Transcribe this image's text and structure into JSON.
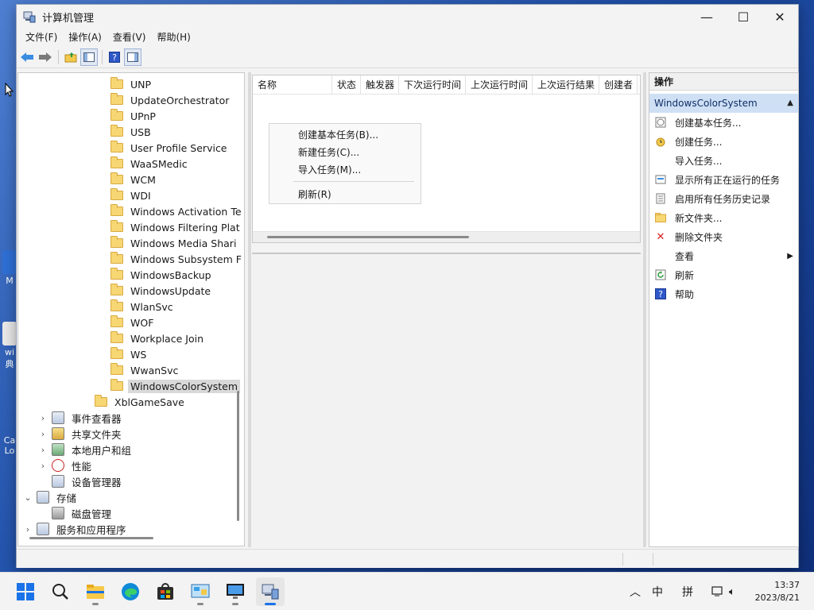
{
  "window": {
    "title": "计算机管理",
    "controls": {
      "minimize": "—",
      "maximize": "☐",
      "close": "✕"
    }
  },
  "menubar": [
    "文件(F)",
    "操作(A)",
    "查看(V)",
    "帮助(H)"
  ],
  "tree": {
    "folders": [
      "UNP",
      "UpdateOrchestrator",
      "UPnP",
      "USB",
      "User Profile Service",
      "WaaSMedic",
      "WCM",
      "WDI",
      "Windows Activation Te",
      "Windows Filtering Plat",
      "Windows Media Shari",
      "Windows Subsystem F",
      "WindowsBackup",
      "WindowsUpdate",
      "WlanSvc",
      "WOF",
      "Workplace Join",
      "WS",
      "WwanSvc",
      "WindowsColorSystem"
    ],
    "selected": "WindowsColorSystem",
    "xbl": "XblGameSave",
    "nodes": [
      {
        "label": "事件查看器",
        "expander": "›"
      },
      {
        "label": "共享文件夹",
        "expander": "›"
      },
      {
        "label": "本地用户和组",
        "expander": "›"
      },
      {
        "label": "性能",
        "expander": "›"
      },
      {
        "label": "设备管理器",
        "expander": ""
      }
    ],
    "storage": {
      "label": "存储",
      "expander": "⌄"
    },
    "disk": {
      "label": "磁盘管理"
    },
    "services": {
      "label": "服务和应用程序",
      "expander": "›"
    }
  },
  "columns": [
    "名称",
    "状态",
    "触发器",
    "下次运行时间",
    "上次运行时间",
    "上次运行结果",
    "创建者"
  ],
  "context_menu": {
    "items": [
      "创建基本任务(B)...",
      "新建任务(C)...",
      "导入任务(M)..."
    ],
    "refresh": "刷新(R)"
  },
  "actions": {
    "title": "操作",
    "section": "WindowsColorSystem",
    "items": [
      {
        "label": "创建基本任务...",
        "icon": "basic-task-icon"
      },
      {
        "label": "创建任务...",
        "icon": "create-task-icon"
      },
      {
        "label": "导入任务...",
        "icon": ""
      },
      {
        "label": "显示所有正在运行的任务",
        "icon": "running-tasks-icon"
      },
      {
        "label": "启用所有任务历史记录",
        "icon": "history-icon"
      },
      {
        "label": "新文件夹...",
        "icon": "folder-icon"
      },
      {
        "label": "删除文件夹",
        "icon": "delete-icon"
      },
      {
        "label": "查看",
        "icon": "",
        "submenu": true
      },
      {
        "label": "刷新",
        "icon": "refresh-icon"
      },
      {
        "label": "帮助",
        "icon": "help-icon"
      }
    ]
  },
  "desktop_icons": [
    {
      "label": "M"
    },
    {
      "label": "wi 典"
    },
    {
      "label": "Ca Lo"
    }
  ],
  "taskbar": {
    "tray": {
      "ime": "中",
      "pinyin": "拼"
    },
    "clock": {
      "time": "13:37",
      "date": "2023/8/21"
    }
  },
  "colors": {
    "accent": "#1a73e8",
    "selection": "#cfe0f5",
    "folder": "#f7d774"
  }
}
